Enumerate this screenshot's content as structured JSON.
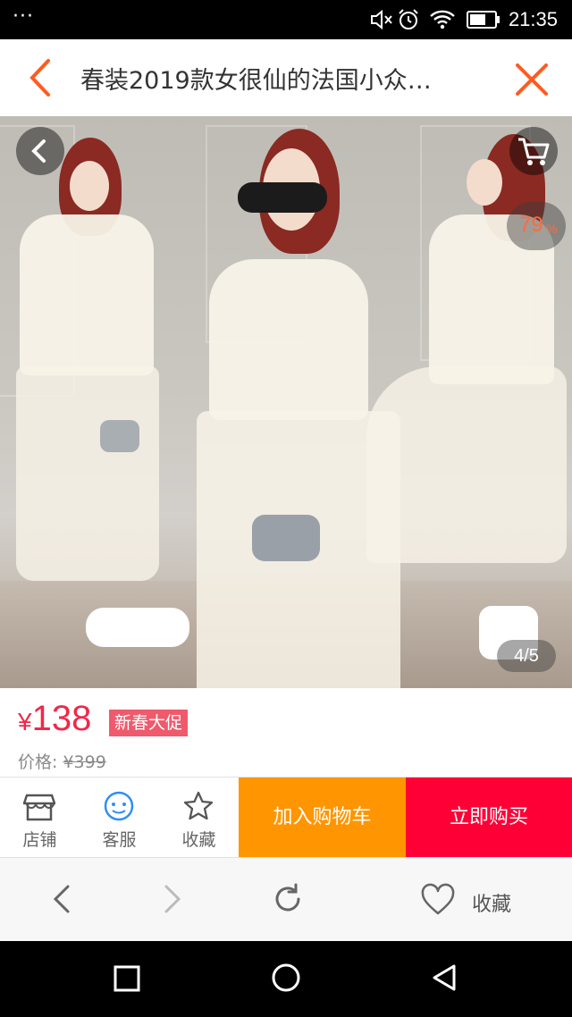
{
  "status_bar": {
    "menu_dots": "···",
    "time": "21:35"
  },
  "title_bar": {
    "title": "春装2019款女很仙的法国小众…"
  },
  "gallery": {
    "progress_percent": "79",
    "progress_unit": "%",
    "page_indicator": "4/5"
  },
  "price": {
    "currency_symbol": "¥",
    "amount": "138",
    "promo_badge": "新春大促",
    "original_label": "价格:",
    "original_price": "¥399"
  },
  "actions": {
    "shop_label": "店铺",
    "service_label": "客服",
    "favorite_label": "收藏",
    "add_to_cart_label": "加入购物车",
    "buy_now_label": "立即购买"
  },
  "browser_nav": {
    "favorite_label": "收藏"
  },
  "colors": {
    "price_red": "#f0284a",
    "accent_orange": "#ff9500",
    "buy_red": "#ff0036",
    "title_icon_orange": "#ff5b1f"
  }
}
